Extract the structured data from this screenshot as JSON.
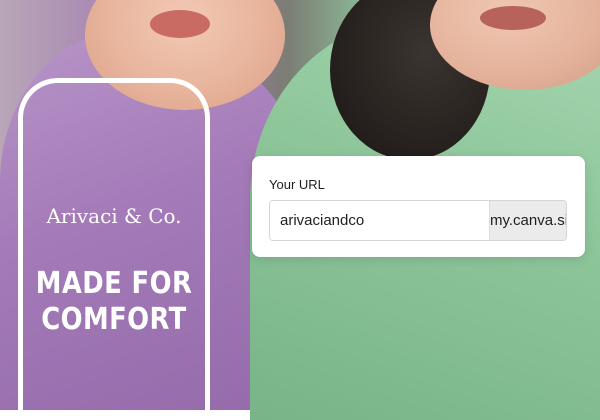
{
  "overlay": {
    "brand_name": "Arivaci & Co.",
    "headline_line1": "MADE FOR",
    "headline_line2": "COMFORT"
  },
  "url_form": {
    "label": "Your URL",
    "value": "arivaciandco",
    "suffix": "my.canva.site"
  },
  "colors": {
    "jacket": "#a47bb8",
    "shirt": "#8fc79b",
    "card": "#ffffff",
    "suffix_bg": "#ebebec"
  }
}
